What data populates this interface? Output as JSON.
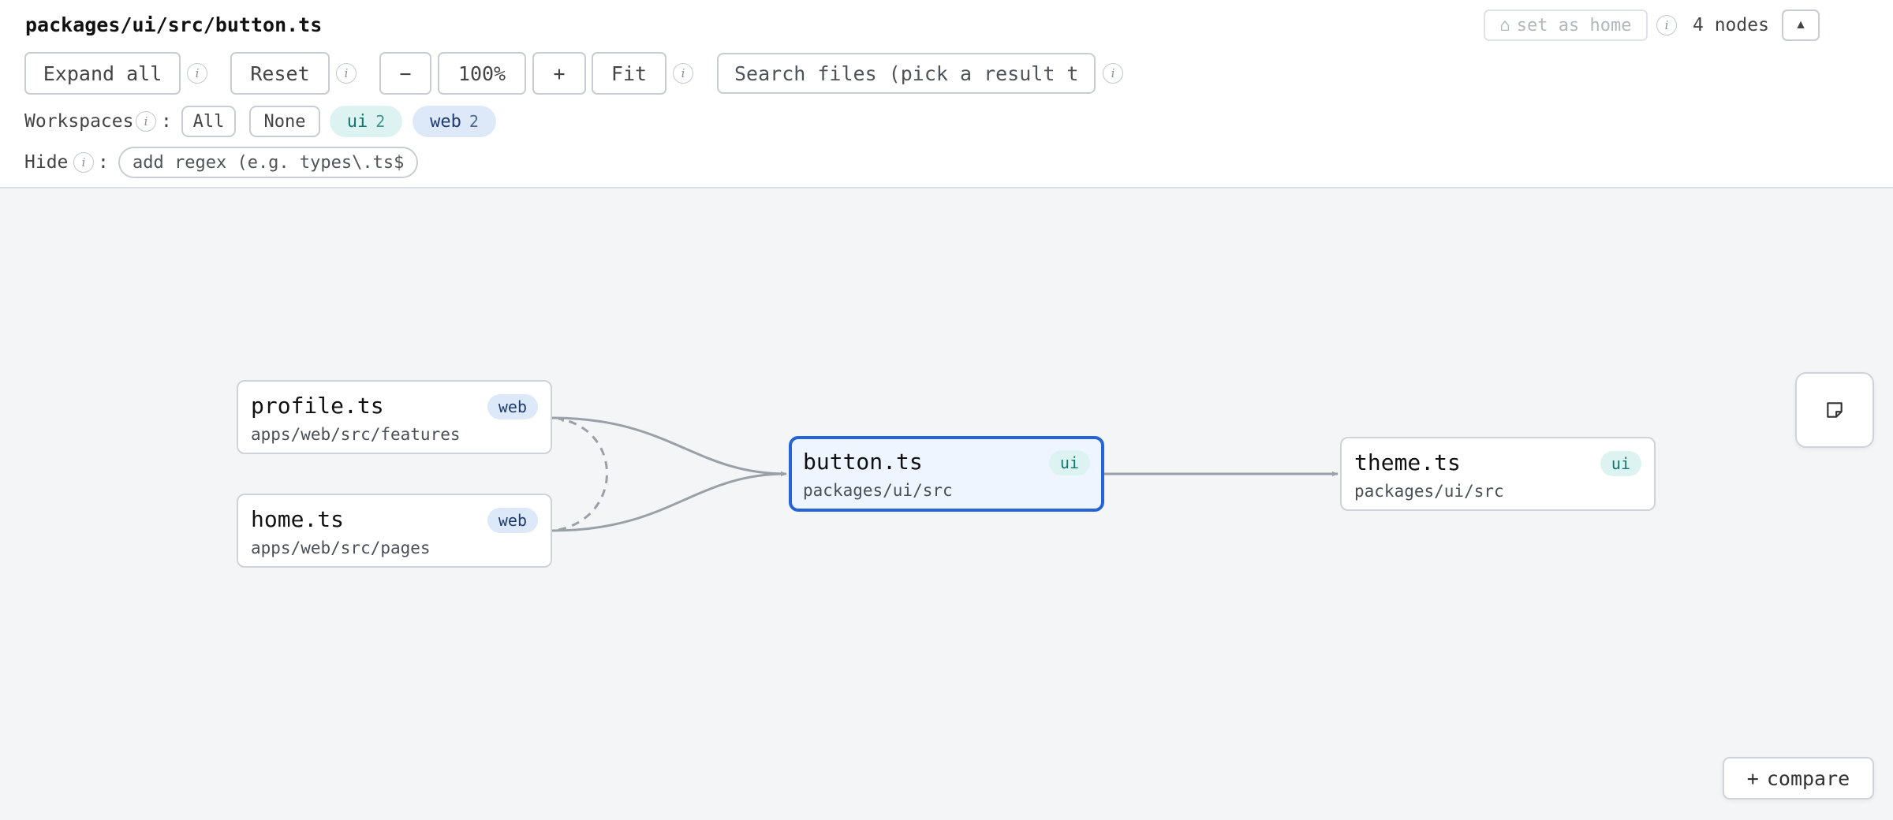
{
  "header": {
    "path": "packages/ui/src/button.ts",
    "set_home_icon": "⌂",
    "set_home_label": "set as home",
    "nodes_count": "4 nodes",
    "collapse_icon": "▲"
  },
  "toolbar": {
    "expand_all": "Expand all",
    "reset": "Reset",
    "zoom_out": "−",
    "zoom_level": "100%",
    "zoom_in": "+",
    "fit": "Fit",
    "search_placeholder": "Search files (pick a result to re-root)",
    "info_glyph": "i"
  },
  "workspaces": {
    "label": "Workspaces",
    "colon": ":",
    "all": "All",
    "none": "None",
    "items": [
      {
        "name": "ui",
        "count": "2",
        "color": "#0f766e",
        "bg": "#ddf3f2"
      },
      {
        "name": "web",
        "count": "2",
        "color": "#1e3a6e",
        "bg": "#dde9f8"
      }
    ]
  },
  "hide": {
    "label": "Hide",
    "colon": ":",
    "placeholder": "add regex (e.g. types\\.ts$)"
  },
  "graph": {
    "nodes": [
      {
        "id": "profile",
        "name": "profile.ts",
        "dir": "apps/web/src/features",
        "workspace": "web"
      },
      {
        "id": "home",
        "name": "home.ts",
        "dir": "apps/web/src/pages",
        "workspace": "web"
      },
      {
        "id": "button",
        "name": "button.ts",
        "dir": "packages/ui/src",
        "workspace": "ui",
        "selected": true
      },
      {
        "id": "theme",
        "name": "theme.ts",
        "dir": "packages/ui/src",
        "workspace": "ui"
      }
    ],
    "edges": [
      {
        "from": "profile",
        "to": "button",
        "style": "solid"
      },
      {
        "from": "home",
        "to": "button",
        "style": "solid"
      },
      {
        "from": "home",
        "to": "profile",
        "style": "dashed"
      },
      {
        "from": "button",
        "to": "theme",
        "style": "solid"
      }
    ],
    "colors": {
      "selected_border": "#2563d9",
      "edge": "#9aa0a8"
    }
  },
  "actions": {
    "notes_icon": "sticky-note-icon",
    "compare_icon": "+",
    "compare_label": "compare"
  }
}
